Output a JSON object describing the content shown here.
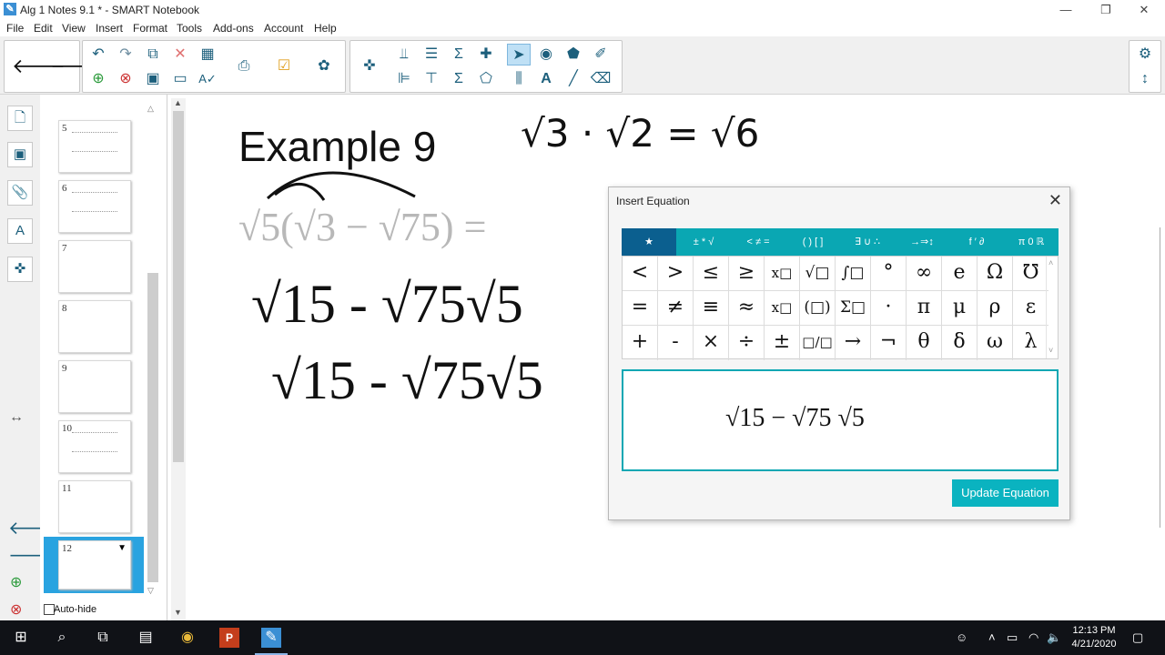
{
  "window": {
    "title": "Alg 1 Notes 9.1 * - SMART Notebook",
    "app_icon": "smart-notebook-icon",
    "controls": [
      "—",
      "❐",
      "✕"
    ]
  },
  "menu": [
    "File",
    "Edit",
    "View",
    "Insert",
    "Format",
    "Tools",
    "Add-ons",
    "Account",
    "Help"
  ],
  "toolbar": {
    "icons": [
      "back-arrow-icon",
      "forward-arrow-icon",
      "undo-icon",
      "redo-icon",
      "add-page-icon",
      "delete-icon",
      "table-icon",
      "screen-capture-icon",
      "check-icon",
      "gallery-icon",
      "puzzle-icon",
      "select-icon",
      "pen-icon",
      "text-icon",
      "eraser-icon",
      "settings-icon"
    ]
  },
  "sorter": {
    "page_numbers": [
      "5",
      "6",
      "7",
      "8",
      "9",
      "10",
      "11",
      "12"
    ],
    "auto_hide_label": "Auto-hide"
  },
  "canvas": {
    "heading": "Example 9",
    "handwritten_top": "√3 · √2 = √6",
    "faded_expr": "√5(√3 − √75) =",
    "line1": "√15 - √75√5",
    "line2": "√15 - √75√5"
  },
  "dialog": {
    "title": "Insert Equation",
    "close": "✕",
    "tabs": [
      "★",
      "± * √",
      "< ≠ =",
      "( ) [ ]",
      "∃ ∪ ∴",
      "→⇒↕",
      "f ′ ∂",
      "π 0 ℝ"
    ],
    "symbols_row1": [
      "<",
      ">",
      "≤",
      "≥",
      "x□",
      "√□",
      "∫□",
      "°",
      "∞",
      "e",
      "Ω",
      "℧"
    ],
    "symbols_row2": [
      "=",
      "≠",
      "≡",
      "≈",
      "x□",
      "(□)",
      "Σ□",
      "·",
      "π",
      "μ",
      "ρ",
      "ε"
    ],
    "symbols_row3": [
      "+",
      "-",
      "×",
      "÷",
      "±",
      "□/□",
      "→",
      "¬",
      "θ",
      "δ",
      "ω",
      "λ"
    ],
    "equation": "√15 − √75 √5",
    "update_button": "Update Equation"
  },
  "taskbar": {
    "time": "12:13 PM",
    "date": "4/21/2020"
  },
  "colors": {
    "accent_teal": "#0aa7b3",
    "tab_active": "#0b5f8f",
    "taskbar": "#101217"
  }
}
